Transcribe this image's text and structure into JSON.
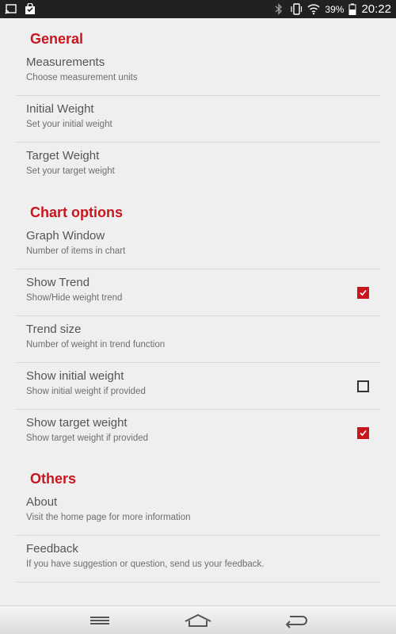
{
  "status_bar": {
    "left_icons": [
      "cast-icon",
      "shopping-bag-icon"
    ],
    "right_icons": [
      "bluetooth-icon",
      "vibrate-icon",
      "wifi-icon"
    ],
    "battery": "39%",
    "time": "20:22"
  },
  "sections": {
    "general": "General",
    "chart_options": "Chart options",
    "others": "Others"
  },
  "items": {
    "measurements": {
      "title": "Measurements",
      "subtitle": "Choose measurement units"
    },
    "initial_weight": {
      "title": "Initial Weight",
      "subtitle": "Set your initial weight"
    },
    "target_weight": {
      "title": "Target Weight",
      "subtitle": "Set your target weight"
    },
    "graph_window": {
      "title": "Graph Window",
      "subtitle": "Number of items in chart"
    },
    "show_trend": {
      "title": "Show Trend",
      "subtitle": "Show/Hide weight trend",
      "checked": true
    },
    "trend_size": {
      "title": "Trend size",
      "subtitle": "Number of weight in trend function"
    },
    "show_initial_weight": {
      "title": "Show initial weight",
      "subtitle": "Show initial weight if provided",
      "checked": false
    },
    "show_target_weight": {
      "title": "Show target weight",
      "subtitle": "Show target weight if provided",
      "checked": true
    },
    "about": {
      "title": "About",
      "subtitle": "Visit the home page for more information"
    },
    "feedback": {
      "title": "Feedback",
      "subtitle": "If you have suggestion or question, send us your feedback."
    }
  },
  "nav": {
    "icons": [
      "menu-icon",
      "home-icon",
      "back-icon"
    ]
  },
  "colors": {
    "accent": "#c8161e",
    "background": "#efefef",
    "status_bar": "#212121"
  }
}
